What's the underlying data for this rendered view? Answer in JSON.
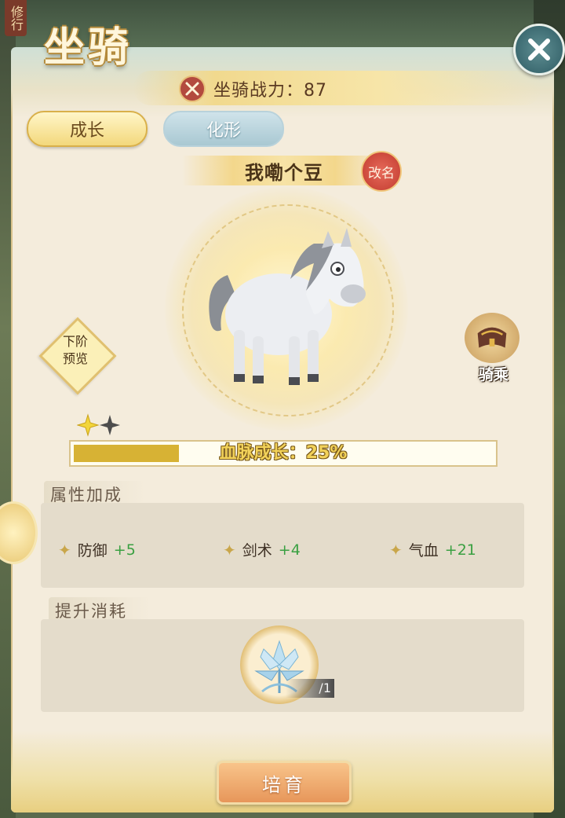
{
  "side_tag": "修行",
  "title": "坐骑",
  "power": {
    "label": "坐骑战力：87"
  },
  "tabs": [
    {
      "label": "成长",
      "active": true
    },
    {
      "label": "化形",
      "active": false
    }
  ],
  "mount": {
    "name": "我嘞个豆",
    "rename_label": "改名"
  },
  "preview": {
    "label": "下阶\n预览"
  },
  "ride": {
    "label": "骑乘"
  },
  "growth": {
    "label": "血脉成长：25%",
    "progress": 0.25
  },
  "stars": {
    "filled": 1,
    "total": 2
  },
  "attributes": {
    "title": "属性加成",
    "items": [
      {
        "name": "防御",
        "value": "+5"
      },
      {
        "name": "剑术",
        "value": "+4"
      },
      {
        "name": "气血",
        "value": "+21"
      }
    ]
  },
  "cost": {
    "title": "提升消耗",
    "item_count": "/1"
  },
  "actions": {
    "nurture_label": "培育"
  },
  "colors": {
    "accent": "#d7b234",
    "bonus": "#3aa042",
    "close": "#3d6b72"
  }
}
